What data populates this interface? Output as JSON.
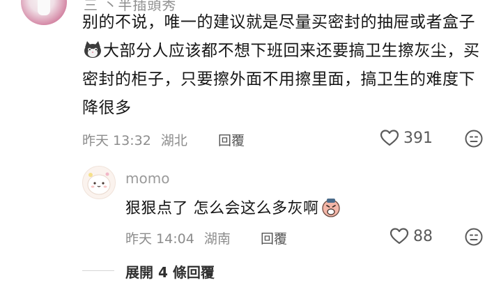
{
  "comment": {
    "author_partial": "三 丶半插頭秀",
    "text_part1": "别的不说，唯一的建议就是尽量买密封的抽屉或者盒子",
    "emoji1": "cat-face-emoji",
    "text_part2": "大部分人应该都不想下班回来还要搞卫生擦灰尘，买密封的柜子，只要擦外面不用擦里面，搞卫生的难度下降很多",
    "time": "昨天 13:32",
    "location": "湖北",
    "reply_label": "回覆",
    "likes": "391"
  },
  "reply": {
    "author": "momo",
    "text": "狠狠点了 怎么会这么多灰啊",
    "emoji": "weary-face-emoji",
    "time": "昨天 14:04",
    "location": "湖南",
    "reply_label": "回覆",
    "likes": "88"
  },
  "expand_label": "展開 4 條回覆",
  "colors": {
    "text": "#161616",
    "meta": "#8c8c8c",
    "icon": "#5a5a5a"
  }
}
